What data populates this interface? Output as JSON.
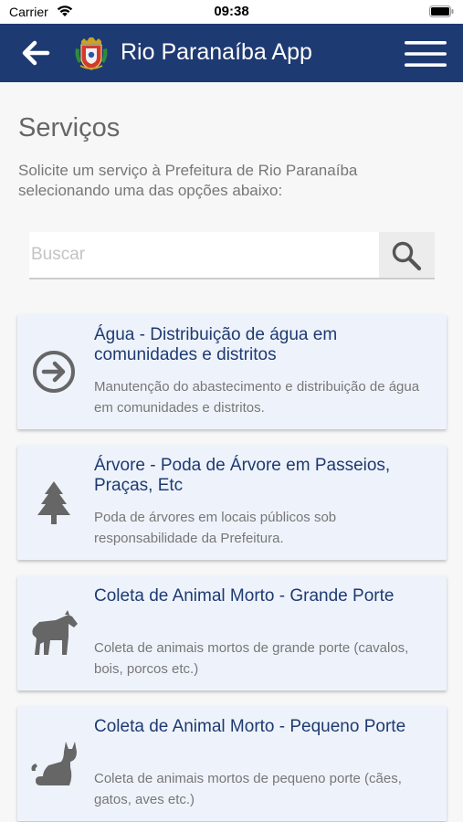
{
  "status": {
    "carrier": "Carrier",
    "time": "09:38"
  },
  "header": {
    "title": "Rio Paranaíba App"
  },
  "page": {
    "title": "Serviços",
    "subtitle": "Solicite um serviço à Prefeitura de Rio Paranaíba selecionando uma das opções abaixo:"
  },
  "search": {
    "placeholder": "Buscar",
    "value": ""
  },
  "services": [
    {
      "title": "Água - Distribuição de água em comunidades e distritos",
      "description": "Manutenção do abastecimento e distribuição de água em comunidades e distritos.",
      "icon": "arrow-circle-right-icon"
    },
    {
      "title": "Árvore - Poda de Árvore em Passeios, Praças, Etc",
      "description": "Poda de árvores em locais públicos sob responsabilidade da Prefeitura.",
      "icon": "tree-icon"
    },
    {
      "title": "Coleta de Animal Morto - Grande Porte",
      "description": "Coleta de animais mortos de grande porte (cavalos, bois, porcos etc.)",
      "icon": "horse-icon"
    },
    {
      "title": "Coleta de Animal Morto - Pequeno Porte",
      "description": "Coleta de animais mortos de pequeno porte (cães, gatos, aves etc.)",
      "icon": "cat-icon"
    }
  ],
  "colors": {
    "header_bg": "#1e3a72",
    "card_bg": "#eef3fb",
    "card_title": "#1e3a72",
    "icon_gray": "#666666",
    "text_gray": "#777777"
  }
}
